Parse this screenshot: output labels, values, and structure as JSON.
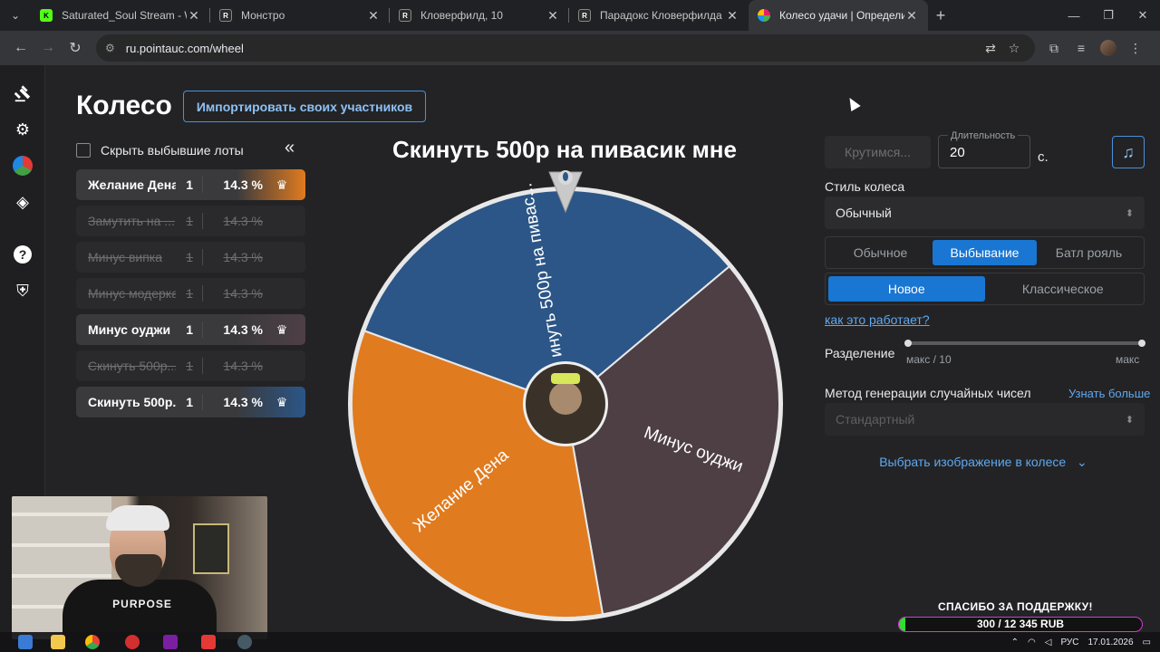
{
  "browser": {
    "tabs": [
      {
        "title": "Saturated_Soul Stream - Watch",
        "favicon": "kick-icon",
        "color": "#53fc18",
        "glyph": "K"
      },
      {
        "title": "Монстро",
        "favicon": "rezka-icon",
        "color": "#2b2b2b",
        "glyph": "R"
      },
      {
        "title": "Кловерфилд, 10",
        "favicon": "rezka-icon",
        "color": "#2b2b2b",
        "glyph": "R"
      },
      {
        "title": "Парадокс Кловерфилда",
        "favicon": "rezka-icon",
        "color": "#2b2b2b",
        "glyph": "R"
      },
      {
        "title": "Колесо удачи | Определите по",
        "favicon": "pointauc-icon",
        "color": "#e91e63",
        "glyph": "●"
      }
    ],
    "url": "ru.pointauc.com/wheel"
  },
  "page": {
    "title": "Колесо",
    "import_label": "Импортировать своих участников",
    "hide_label": "Скрыть выбывшие лоты",
    "wheel_title": "Скинуть 500р на пивасик мне"
  },
  "lots": [
    {
      "name": "Желание Дена",
      "amount": "1",
      "percent": "14.3 %",
      "state": "active",
      "color": "#e07b1f"
    },
    {
      "name": "Замутить на ...",
      "amount": "1",
      "percent": "14.3 %",
      "state": "out",
      "color": ""
    },
    {
      "name": "Минус випка",
      "amount": "1",
      "percent": "14.3 %",
      "state": "out",
      "color": ""
    },
    {
      "name": "Минус модерка",
      "amount": "1",
      "percent": "14.3 %",
      "state": "out",
      "color": ""
    },
    {
      "name": "Минус оуджи",
      "amount": "1",
      "percent": "14.3 %",
      "state": "active",
      "color": "#4e3f45"
    },
    {
      "name": "Скинуть 500р...",
      "amount": "1",
      "percent": "14.3 %",
      "state": "out",
      "color": ""
    },
    {
      "name": "Скинуть 500р...",
      "amount": "1",
      "percent": "14.3 %",
      "state": "active",
      "color": "#2b5687"
    }
  ],
  "wheel": {
    "segments": [
      {
        "label": "инуть 500р на пивас...",
        "color": "#2b5687",
        "share": 0.3333
      },
      {
        "label": "Минус оуджи",
        "color": "#4e3f45",
        "share": 0.3333
      },
      {
        "label": "Желание Дена",
        "color": "#e07b1f",
        "share": 0.3333
      }
    ]
  },
  "controls": {
    "spin_label": "Крутимся...",
    "duration_label": "Длительность",
    "duration_value": "20",
    "duration_unit": "с.",
    "wheel_style_label": "Стиль колеса",
    "wheel_style_value": "Обычный",
    "mode_options": [
      "Обычное",
      "Выбывание",
      "Батл рояль"
    ],
    "mode_selected": "Выбывание",
    "variant_options": [
      "Новое",
      "Классическое"
    ],
    "variant_selected": "Новое",
    "how_link": "как это работает?",
    "split_label": "Разделение",
    "split_min": "макс / 10",
    "split_max": "макс",
    "rng_label": "Метод генерации случайных чисел",
    "rng_learn": "Узнать больше",
    "rng_value": "Стандартный",
    "pick_image": "Выбрать изображение в колесе"
  },
  "overlay": {
    "webcam_print": "PURPOSE",
    "donate_title": "СПАСИБО ЗА ПОДДЕРЖКУ!",
    "donate_amount": "300 / 12 345 RUB",
    "donate_progress": 0.0243
  },
  "taskbar": {
    "lang": "РУС",
    "date": "17.01.2026"
  },
  "colors": {
    "accent": "#1976d2",
    "link": "#5fa8f0"
  }
}
